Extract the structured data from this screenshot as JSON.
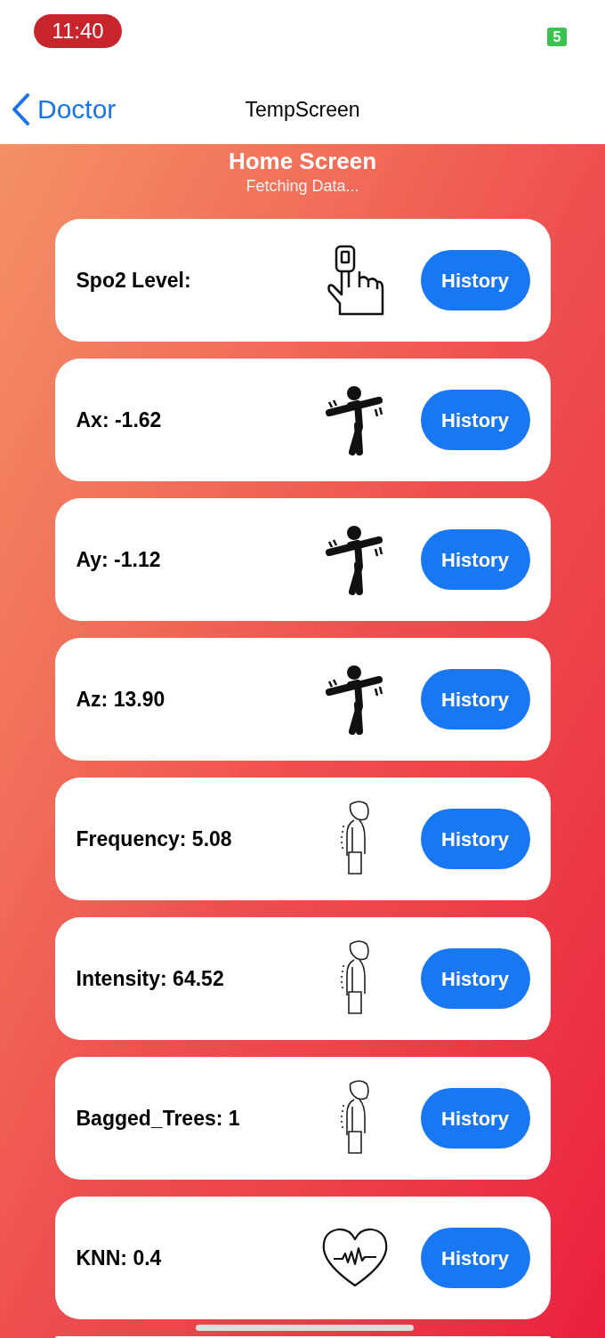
{
  "status_bar": {
    "time": "11:40",
    "battery": "5"
  },
  "nav": {
    "back": "Doctor",
    "title": "TempScreen"
  },
  "header": {
    "title": "Home Screen",
    "subtitle": "Fetching Data..."
  },
  "cards": [
    {
      "label": "Spo2 Level:",
      "kind": "oximeter",
      "button": "History"
    },
    {
      "label": "Ax: -1.62",
      "kind": "motion",
      "button": "History"
    },
    {
      "label": "Ay: -1.12",
      "kind": "motion",
      "button": "History"
    },
    {
      "label": "Az: 13.90",
      "kind": "motion",
      "button": "History"
    },
    {
      "label": "Frequency: 5.08",
      "kind": "posture",
      "button": "History"
    },
    {
      "label": "Intensity: 64.52",
      "kind": "posture",
      "button": "History"
    },
    {
      "label": "Bagged_Trees: 1",
      "kind": "posture",
      "button": "History"
    },
    {
      "label": "KNN: 0.4",
      "kind": "heart",
      "button": "History"
    }
  ]
}
